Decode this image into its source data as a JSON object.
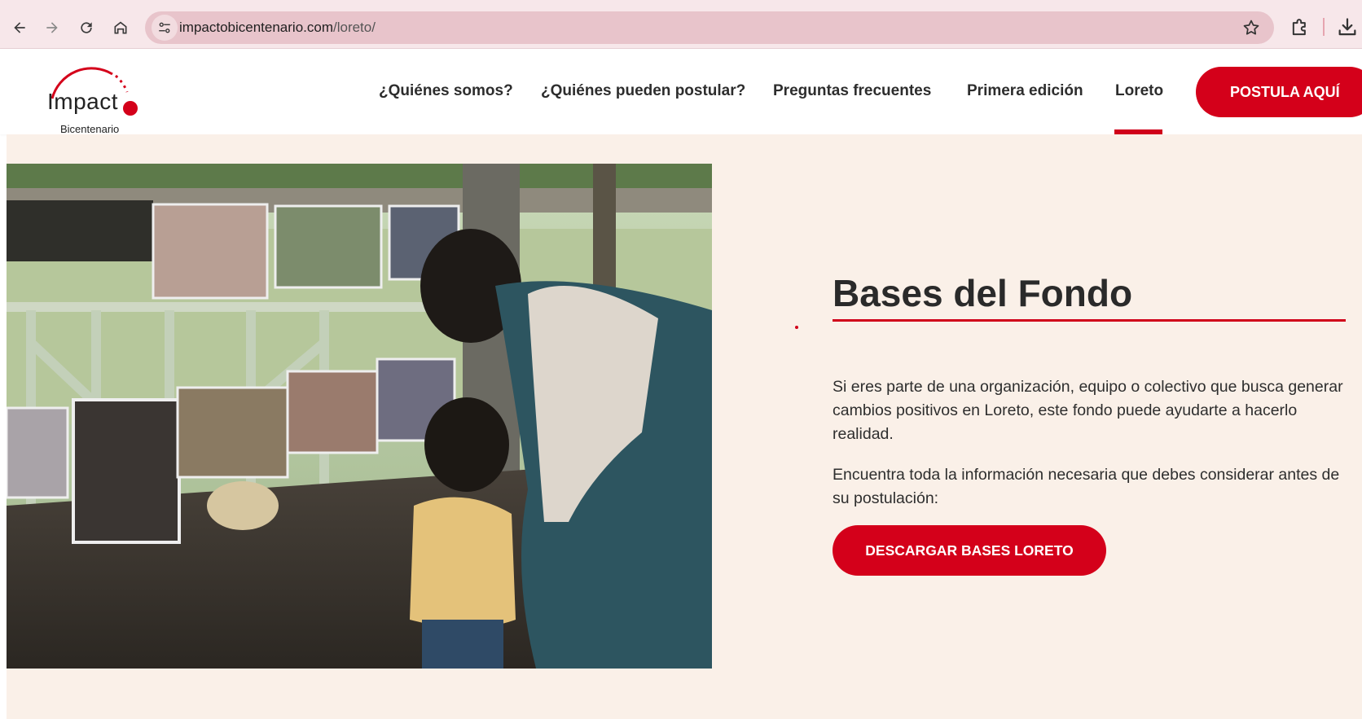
{
  "browser": {
    "url_domain": "impactobicentenario.com",
    "url_path": "/loreto/",
    "icons": {
      "back": "arrow-left-icon",
      "forward": "arrow-right-icon",
      "reload": "reload-icon",
      "home": "home-icon",
      "site_info": "tune-icon",
      "bookmark": "star-icon",
      "extensions": "puzzle-icon",
      "download": "download-icon"
    }
  },
  "header": {
    "logo_word": "Impact",
    "logo_sub": "Bicentenario",
    "nav": [
      {
        "label": "¿Quiénes somos?"
      },
      {
        "label": "¿Quiénes pueden postular?"
      },
      {
        "label": "Preguntas frecuentes"
      },
      {
        "label": "Primera edición"
      },
      {
        "label": "Loreto",
        "active": true
      }
    ],
    "cta_label": "POSTULA AQUÍ"
  },
  "main": {
    "title": "Bases del Fondo",
    "paragraph_1": "Si eres parte de una organización, equipo o colectivo que busca generar cambios positivos en Loreto, este fondo puede ayudarte a hacerlo realidad.",
    "paragraph_2": "Encuentra toda la información necesaria que debes considerar antes de su postulación:",
    "download_label": "DESCARGAR BASES LORETO"
  },
  "colors": {
    "brand_red": "#d4001a",
    "background": "#faf0e8",
    "browser_bar": "#f7e7ea",
    "address_bar": "#e8c4cb"
  }
}
